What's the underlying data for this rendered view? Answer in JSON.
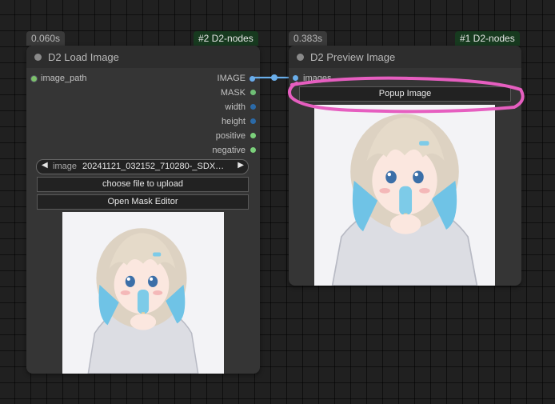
{
  "load_node": {
    "time": "0.060s",
    "pack": "#2 D2-nodes",
    "title": "D2 Load Image",
    "input_label": "image_path",
    "outputs": [
      "IMAGE",
      "MASK",
      "width",
      "height",
      "positive",
      "negative"
    ],
    "image_widget_label": "image",
    "image_widget_value": "20241121_032152_710280-_SDX…",
    "upload_button": "choose file to upload",
    "mask_button": "Open Mask Editor"
  },
  "preview_node": {
    "time": "0.383s",
    "pack": "#1 D2-nodes",
    "title": "D2 Preview Image",
    "input_label": "images",
    "popup_button": "Popup Image"
  },
  "icons": [
    "arrow-left-icon",
    "arrow-right-icon",
    "node-status-dot-icon"
  ],
  "colors": {
    "image_link": "#6aaeea",
    "mask_slot": "#6fbf76",
    "int_slot": "#2b6aa8",
    "positive_slot": "#7bd17b",
    "annotation": "#e65ec0",
    "pack_badge_bg": "#173a1f"
  }
}
